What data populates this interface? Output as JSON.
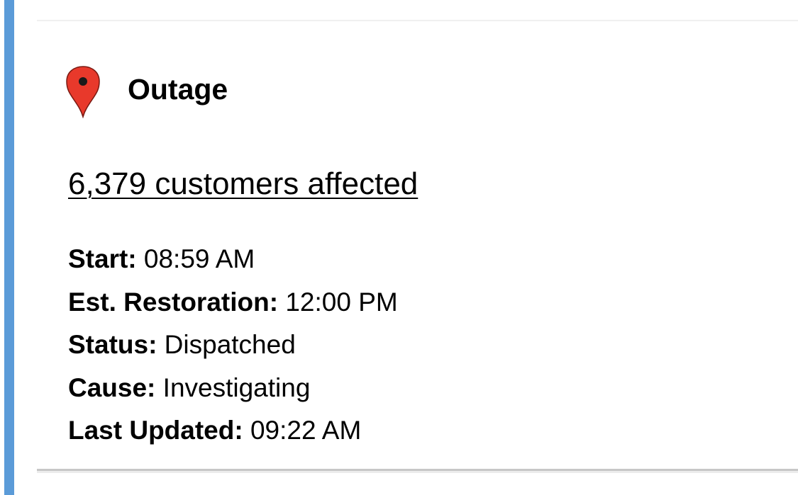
{
  "card": {
    "title": "Outage",
    "icon": "map-pin-icon",
    "pin_color": "#e8392b",
    "accent_color": "#5b9bd8",
    "customers_link": "6,379 customers affected",
    "details": [
      {
        "label": "Start:",
        "value": " 08:59 AM"
      },
      {
        "label": "Est. Restoration:",
        "value": " 12:00 PM"
      },
      {
        "label": "Status:",
        "value": " Dispatched"
      },
      {
        "label": "Cause:",
        "value": " Investigating"
      },
      {
        "label": "Last Updated:",
        "value": " 09:22 AM"
      }
    ]
  }
}
